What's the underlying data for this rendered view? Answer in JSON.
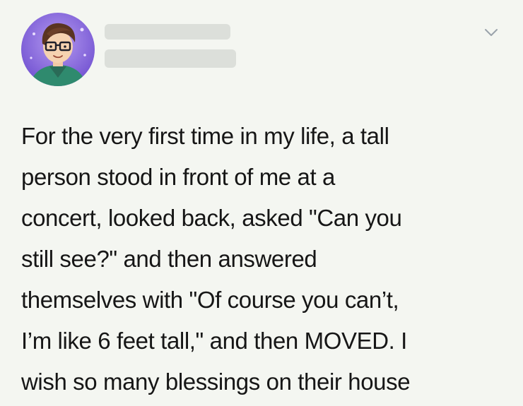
{
  "post": {
    "text": "For the very first time in my life, a tall\nperson stood in front of me at a\nconcert, looked back, asked \"Can you\nstill see?\" and then answered\nthemselves with \"Of course you can’t,\nI’m like 6 feet tall,\" and then MOVED. I\nwish so many blessings on their house",
    "icons": {
      "menu": "chevron-down-icon",
      "avatar": "avatar"
    }
  }
}
